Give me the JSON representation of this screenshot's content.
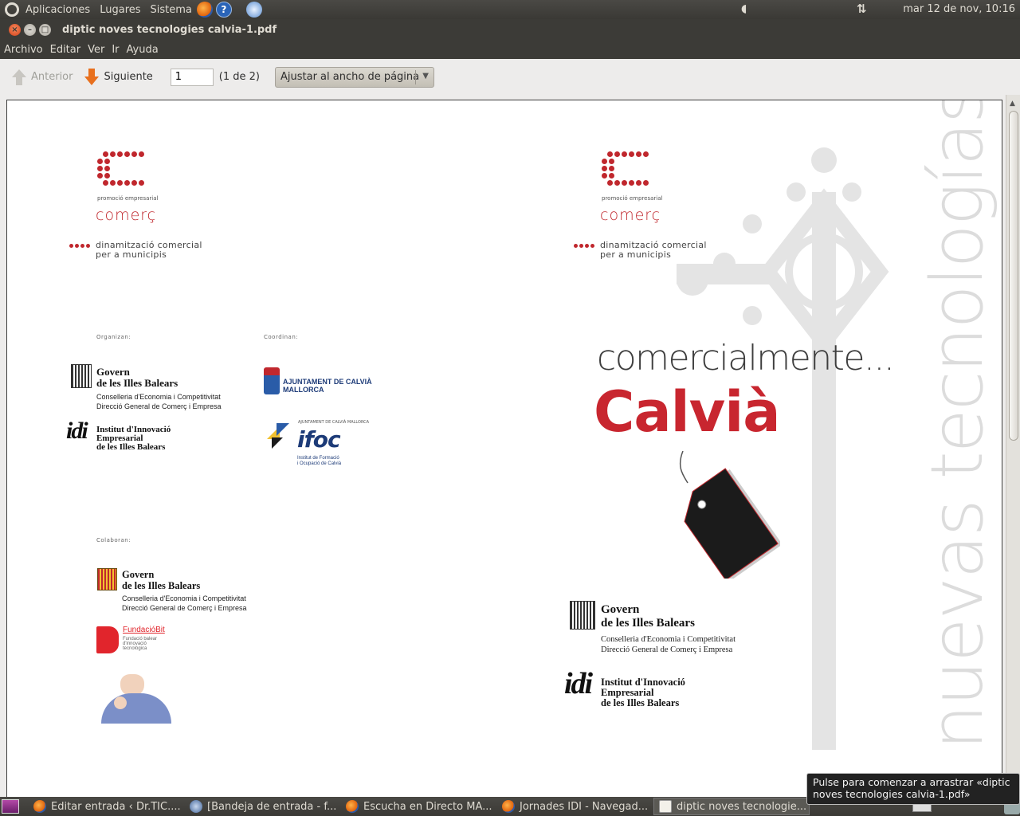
{
  "top_panel": {
    "menus": [
      "Aplicaciones",
      "Lugares",
      "Sistema"
    ],
    "clock": "mar 12 de nov, 10:16"
  },
  "window": {
    "title": "diptic noves tecnologies calvia-1.pdf"
  },
  "menubar": [
    "Archivo",
    "Editar",
    "Ver",
    "Ir",
    "Ayuda"
  ],
  "toolbar": {
    "prev_label": "Anterior",
    "next_label": "Siguiente",
    "page_value": "1",
    "page_count": "(1 de 2)",
    "zoom_value": "Ajustar al ancho de página"
  },
  "document": {
    "left": {
      "logo_sub": "promoció empresarial",
      "logo_word": "comerç",
      "tagline_1": "dinamització comercial",
      "tagline_2": "per a municipis",
      "organizan": "Organizan:",
      "coordinan": "Coordinan:",
      "colaboran": "Colaboran:",
      "govern_1": "Govern",
      "govern_2": "de les Illes Balears",
      "govern_sub_1": "Conselleria d'Economia i Competitivitat",
      "govern_sub_2": "Direcció General de Comerç i Empresa",
      "idi_mark": "idi",
      "idi_1": "Institut d'Innovació",
      "idi_2": "Empresarial",
      "idi_3": "de les Illes Balears",
      "calvia_1": "AJUNTAMENT DE CALVIÀ",
      "calvia_2": "MALLORCA",
      "ifoc_small": "AJUNTAMENT DE CALVIÀ MALLORCA",
      "ifoc_mark": "ifoc",
      "ifoc_sub_1": "Institut de Formació",
      "ifoc_sub_2": "i Ocupació de Calvià",
      "fbit_name": "FundacióBit",
      "fbit_sub_1": "Fundació balear",
      "fbit_sub_2": "d'innovació",
      "fbit_sub_3": "tecnològica"
    },
    "right": {
      "logo_sub": "promoció empresarial",
      "logo_word": "comerç",
      "tagline_1": "dinamització comercial",
      "tagline_2": "per a municipis",
      "headline_1": "comercialmente...",
      "headline_2": "Calvià",
      "vertical": "nuevas tecnologías",
      "govern_1": "Govern",
      "govern_2": "de les Illes Balears",
      "govern_sub_1": "Conselleria d'Economia i Competitivitat",
      "govern_sub_2": "Direcció General de Comerç i Empresa",
      "idi_mark": "idi",
      "idi_1": "Institut d'Innovació",
      "idi_2": "Empresarial",
      "idi_3": "de les Illes Balears"
    }
  },
  "taskbar": {
    "tasks": [
      "Editar entrada ‹ Dr.TIC....",
      "[Bandeja de entrada - f...",
      "Escucha en Directo MA...",
      "Jornades IDI - Navegad...",
      "diptic noves tecnologie..."
    ]
  },
  "tooltip": {
    "line_1": "Pulse para comenzar a arrastrar «diptic",
    "line_2": "noves tecnologies calvia-1.pdf»"
  },
  "colors": {
    "brand_red": "#c0272d",
    "panel_bg": "#3c3b37",
    "toolbar_bg": "#edeceb"
  },
  "icons": [
    "ubuntu-logo-icon",
    "firefox-icon",
    "help-icon",
    "thunderbird-icon",
    "volume-icon",
    "network-icon",
    "close-icon",
    "minimize-icon",
    "maximize-icon",
    "previous-page-icon",
    "next-page-icon",
    "dropdown-arrow-icon"
  ]
}
